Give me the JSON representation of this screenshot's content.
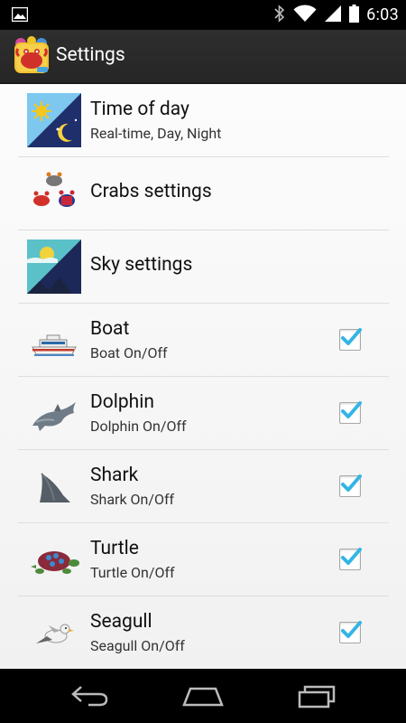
{
  "status_bar": {
    "time": "6:03"
  },
  "action_bar": {
    "title": "Settings"
  },
  "settings": [
    {
      "title": "Time of day",
      "subtitle": "Real-time, Day, Night",
      "icon": "day-night-icon"
    },
    {
      "title": "Crabs settings",
      "subtitle": "",
      "icon": "crabs-icon"
    },
    {
      "title": "Sky settings",
      "subtitle": "",
      "icon": "sky-icon"
    },
    {
      "title": "Boat",
      "subtitle": "Boat On/Off",
      "icon": "boat-icon",
      "checked": true
    },
    {
      "title": "Dolphin",
      "subtitle": "Dolphin On/Off",
      "icon": "dolphin-icon",
      "checked": true
    },
    {
      "title": "Shark",
      "subtitle": "Shark On/Off",
      "icon": "shark-fin-icon",
      "checked": true
    },
    {
      "title": "Turtle",
      "subtitle": "Turtle On/Off",
      "icon": "turtle-icon",
      "checked": true
    },
    {
      "title": "Seagull",
      "subtitle": "Seagull On/Off",
      "icon": "seagull-icon",
      "checked": true
    }
  ],
  "colors": {
    "check_accent": "#33b5e5",
    "action_bar": "#2b2b2b"
  }
}
